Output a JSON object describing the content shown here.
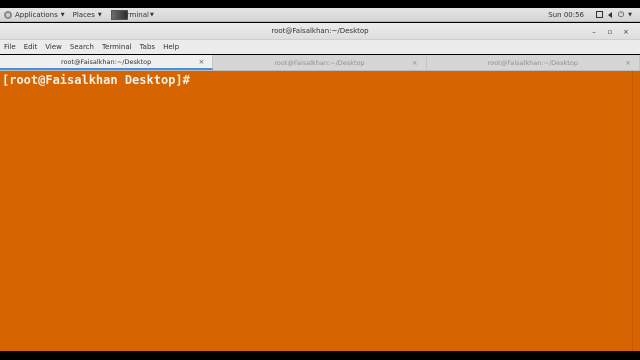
{
  "panel": {
    "applications_label": "Applications",
    "places_label": "Places",
    "task_label": "rminal",
    "clock": "Sun 00:56"
  },
  "window": {
    "title": "root@Faisalkhan:~/Desktop",
    "minimize": "–",
    "maximize": "▫",
    "close": "×"
  },
  "menubar": {
    "items": [
      "File",
      "Edit",
      "View",
      "Search",
      "Terminal",
      "Tabs",
      "Help"
    ]
  },
  "tabs": [
    {
      "label": "root@Faisalkhan:~/Desktop",
      "close": "×"
    },
    {
      "label": "root@Faisalkhan:~/Desktop",
      "close": "×"
    },
    {
      "label": "root@Faisalkhan:~/Desktop",
      "close": "×"
    }
  ],
  "terminal": {
    "prompt": "[root@Faisalkhan Desktop]#",
    "background": "#d66400",
    "text_color": "#f4f1ea"
  },
  "colors": {
    "accent": "#4a90d9"
  }
}
